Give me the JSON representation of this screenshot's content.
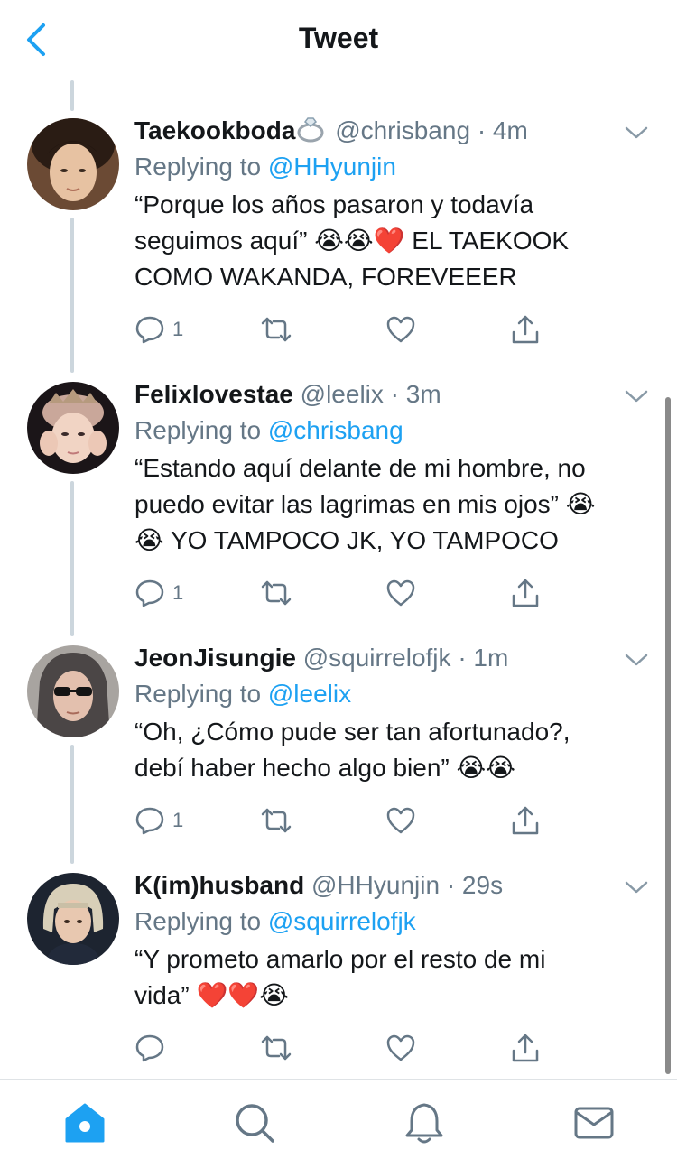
{
  "header": {
    "title": "Tweet",
    "back_icon": "chevron-left-icon"
  },
  "colors": {
    "accent": "#1da1f2",
    "secondary_text": "#657786",
    "primary_text": "#14171a",
    "thread_line": "#ccd6dd"
  },
  "tweets": [
    {
      "name": "Taekookboda",
      "name_emoji": "ring-icon",
      "handle": "@chrisbang",
      "dot": "·",
      "time": "4m",
      "replying_prefix": "Replying to",
      "replying_to": "@HHyunjin",
      "text_lines": [
        "“Porque los años pasaron y todavía",
        "seguimos aquí” 😭😭❤️ EL TAEKOOK",
        "COMO WAKANDA, FOREVEEER"
      ],
      "reply_count": "1"
    },
    {
      "name": "Felixlovestae",
      "handle": "@leelix",
      "dot": "·",
      "time": "3m",
      "replying_prefix": "Replying to",
      "replying_to": "@chrisbang",
      "text_lines": [
        "“Estando aquí delante de mi hombre, no",
        "puedo evitar las lagrimas en mis ojos” 😭",
        "😭 YO TAMPOCO JK, YO TAMPOCO"
      ],
      "reply_count": "1"
    },
    {
      "name": "JeonJisungie",
      "handle": "@squirrelofjk",
      "dot": "·",
      "time": "1m",
      "replying_prefix": "Replying to",
      "replying_to": "@leelix",
      "text_lines": [
        "“Oh, ¿Cómo pude ser tan afortunado?,",
        "debí haber hecho algo bien” 😭😭"
      ],
      "reply_count": "1"
    },
    {
      "name": "K(im)husband",
      "handle": "@HHyunjin",
      "dot": "·",
      "time": "29s",
      "replying_prefix": "Replying to",
      "replying_to": "@squirrelofjk",
      "text_lines": [
        "“Y prometo amarlo por el resto de mi",
        "vida” ❤️❤️😭"
      ],
      "reply_count": ""
    }
  ],
  "action_icons": [
    "reply-icon",
    "retweet-icon",
    "like-icon",
    "share-icon"
  ],
  "tabbar": {
    "items": [
      "home-icon",
      "search-icon",
      "notifications-icon",
      "messages-icon"
    ],
    "active": "home-icon"
  }
}
